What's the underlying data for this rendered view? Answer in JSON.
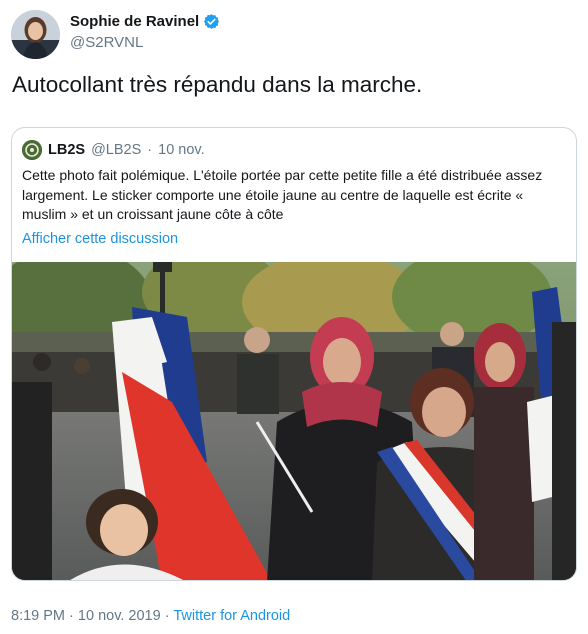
{
  "author": {
    "name": "Sophie de Ravinel",
    "handle": "@S2RVNL"
  },
  "tweet": {
    "text": "Autocollant très répandu dans la marche."
  },
  "quoted": {
    "name": "LB2S",
    "handle": "@LB2S",
    "separator": "·",
    "date": "10 nov.",
    "text": "Cette photo fait polémique. L'étoile portée par cette petite fille a été distribuée assez largement. Le sticker comporte une étoile jaune au centre de laquelle est écrite « muslim » et un croissant jaune côte à côte",
    "link": "Afficher cette discussion"
  },
  "footer": {
    "time": "8:19 PM",
    "separator": "·",
    "date": "10 nov. 2019",
    "source": "Twitter for Android"
  },
  "colors": {
    "accent": "#1b95e0",
    "muted": "#657786",
    "verified": "#1da1f2"
  },
  "icons": [
    "verified-badge-icon"
  ]
}
